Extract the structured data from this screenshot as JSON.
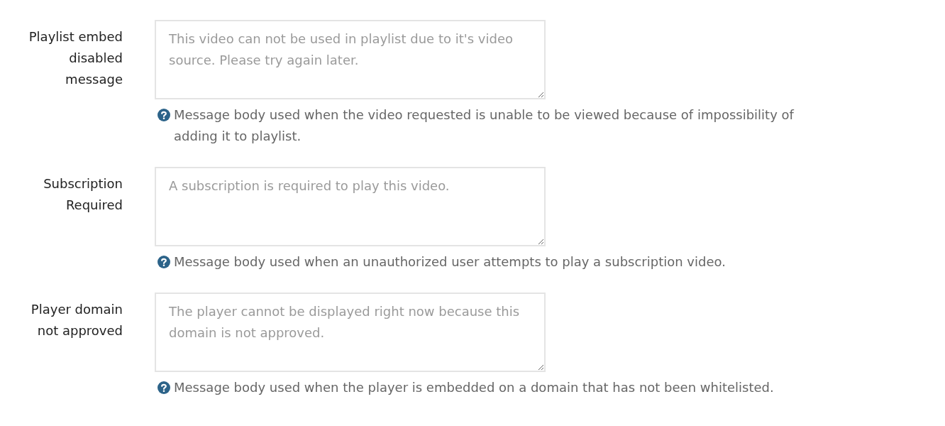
{
  "fields": [
    {
      "label": "Playlist embed disabled message",
      "placeholder": "This video can not be used in playlist due to it's video source. Please try again later.",
      "help": "Message body used when the video requested is unable to be viewed because of impossibility of adding it to playlist."
    },
    {
      "label": "Subscription Required",
      "placeholder": "A subscription is required to play this video.",
      "help": "Message body used when an unauthorized user attempts to play a subscription video."
    },
    {
      "label": "Player domain not approved",
      "placeholder": "The player cannot be displayed right now because this domain is not approved.",
      "help": "Message body used when the player is embedded on a domain that has not been whitelisted."
    }
  ]
}
